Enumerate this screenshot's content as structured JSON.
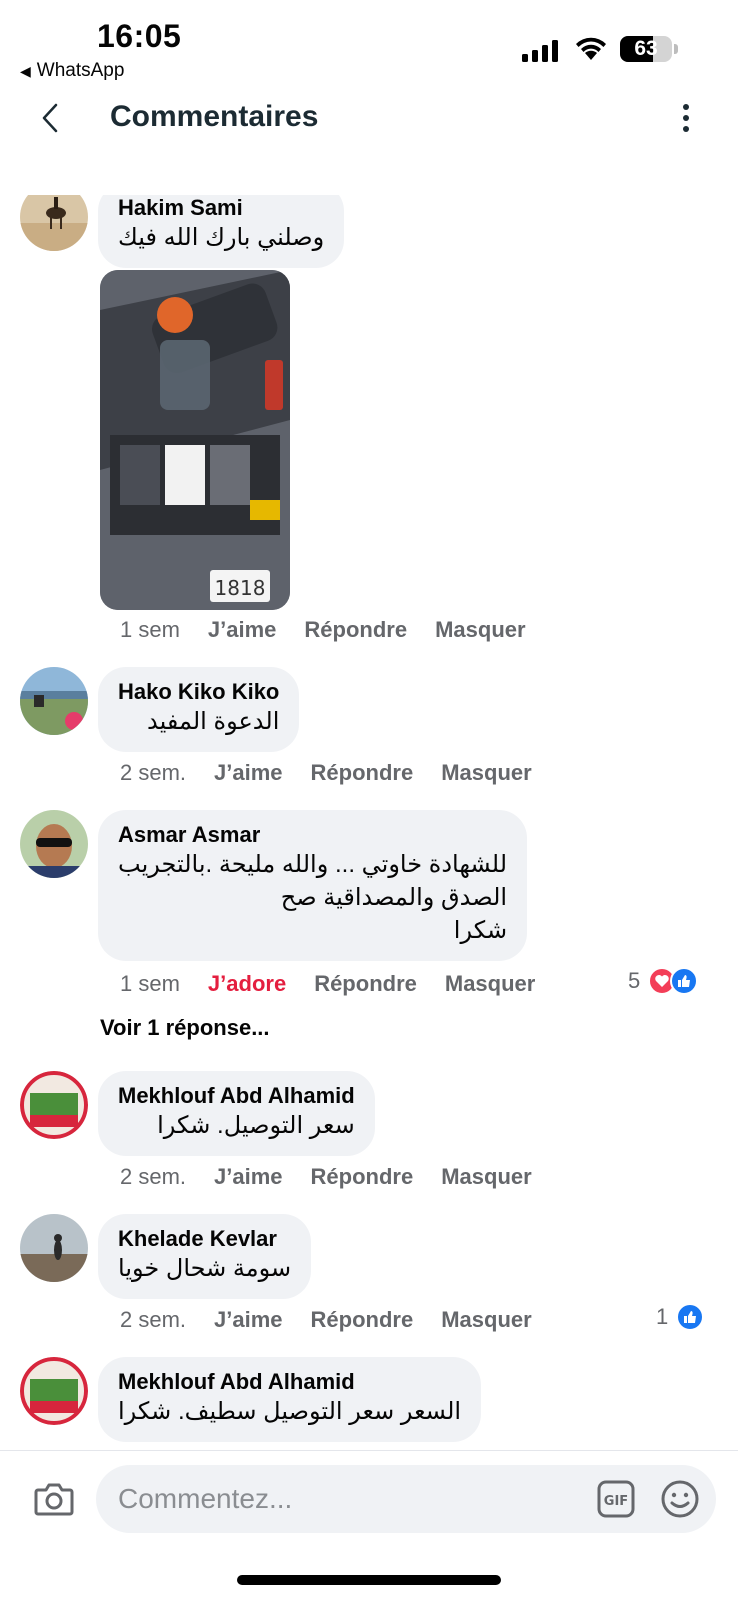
{
  "status_bar": {
    "time": "16:05",
    "back_app": "WhatsApp",
    "battery_level": "63",
    "battery_fraction": 0.63
  },
  "header": {
    "title": "Commentaires"
  },
  "comments": [
    {
      "author": "Hakim Sami",
      "text": [
        "وصلني بارك الله فيك"
      ],
      "has_attachment": true,
      "time": "1 sem",
      "like_label": "J’aime",
      "reply_label": "Répondre",
      "hide_label": "Masquer"
    },
    {
      "author": "Hako Kiko Kiko",
      "text": [
        "الدعوة المفيد"
      ],
      "time": "2 sem.",
      "like_label": "J’aime",
      "reply_label": "Répondre",
      "hide_label": "Masquer"
    },
    {
      "author": "Asmar Asmar",
      "text": [
        "للشهادة خاوتي ... والله مليحة .بالتجريب",
        "الصدق والمصداقية صح",
        "شكرا"
      ],
      "time": "1 sem",
      "like_label": "J’adore",
      "like_color": "#e41e3f",
      "reply_label": "Répondre",
      "hide_label": "Masquer",
      "reaction_count": "5",
      "reactions": [
        "heart-icon",
        "like-icon"
      ],
      "view_replies": "Voir 1 réponse..."
    },
    {
      "author": "Mekhlouf Abd Alhamid",
      "text": [
        "سعر التوصيل. شكرا"
      ],
      "time": "2 sem.",
      "like_label": "J’aime",
      "reply_label": "Répondre",
      "hide_label": "Masquer"
    },
    {
      "author": "Khelade Kevlar",
      "text": [
        "سومة شحال خويا"
      ],
      "time": "2 sem.",
      "like_label": "J’aime",
      "reply_label": "Répondre",
      "hide_label": "Masquer",
      "reaction_count": "1",
      "reactions": [
        "like-icon"
      ]
    },
    {
      "author": "Mekhlouf Abd Alhamid",
      "text": [
        "السعر سعر التوصيل سطيف. شكرا"
      ]
    }
  ],
  "composer": {
    "placeholder": "Commentez...",
    "gif_label": "GIF"
  },
  "colors": {
    "bubble": "#f0f2f5",
    "accent": "#1877f2",
    "love": "#e41e3f",
    "muted_text": "#65676b"
  }
}
